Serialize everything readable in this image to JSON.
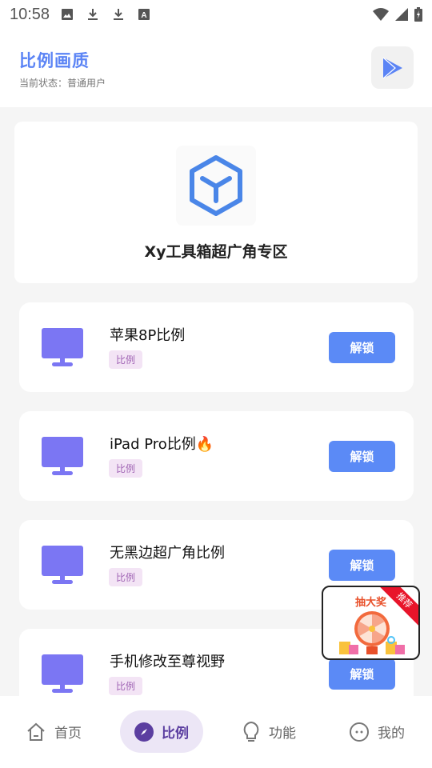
{
  "status_bar": {
    "time": "10:58",
    "left_icons": [
      "image-icon",
      "download-icon",
      "download-icon",
      "text-icon"
    ],
    "right_icons": [
      "wifi-icon",
      "signal-icon",
      "battery-charging-icon"
    ]
  },
  "header": {
    "title": "比例画质",
    "subtitle": "当前状态：普通用户",
    "action_icon": "play-icon"
  },
  "hero": {
    "logo_icon": "cube-y-logo-icon",
    "title": "Xy工具箱超广角专区"
  },
  "items": [
    {
      "name": "苹果8P比例",
      "tag": "比例",
      "button": "解锁",
      "emoji": ""
    },
    {
      "name": "iPad Pro比例",
      "tag": "比例",
      "button": "解锁",
      "emoji": "🔥"
    },
    {
      "name": "无黑边超广角比例",
      "tag": "比例",
      "button": "解锁",
      "emoji": ""
    },
    {
      "name": "手机修改至尊视野",
      "tag": "比例",
      "button": "解锁",
      "emoji": ""
    }
  ],
  "float_ad": {
    "title": "抽大奖",
    "badge": "推荐"
  },
  "tabbar": {
    "tabs": [
      {
        "label": "首页",
        "icon": "home-icon",
        "active": false
      },
      {
        "label": "比例",
        "icon": "compass-icon",
        "active": true
      },
      {
        "label": "功能",
        "icon": "lightbulb-icon",
        "active": false
      },
      {
        "label": "我的",
        "icon": "smiley-icon",
        "active": false
      }
    ]
  },
  "colors": {
    "accent": "#5b8af6",
    "title_blue": "#5b84f5",
    "monitor_purple": "#7b76f3",
    "tag_bg": "#f3e4f5",
    "tag_text": "#a064b4",
    "tab_active_bg": "#ece6f6",
    "tab_active_text": "#5b3ea0"
  }
}
